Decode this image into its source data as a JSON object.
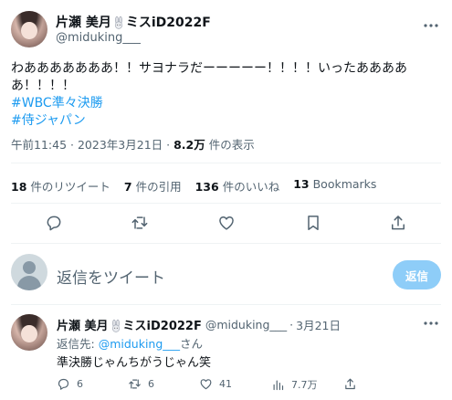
{
  "tweet": {
    "author_name": "片瀬 美月",
    "author_name_suffix": "ミスiD2022F",
    "author_handle": "@miduking___",
    "text": "わあああああああ！！サヨナラだーーーーー！！！！いったあああああ！！！！",
    "hashtags": [
      "#WBC準々決勝",
      "#侍ジャパン"
    ],
    "time": "午前11:45",
    "date": "2023年3月21日",
    "views_count": "8.2万",
    "views_label": "件の表示",
    "separator": "·"
  },
  "stats": [
    {
      "count": "18",
      "label": "件のリツイート"
    },
    {
      "count": "7",
      "label": "件の引用"
    },
    {
      "count": "136",
      "label": "件のいいね"
    },
    {
      "count": "13",
      "label": "Bookmarks"
    }
  ],
  "actions": [
    "reply-icon",
    "retweet-icon",
    "like-icon",
    "bookmark-icon",
    "share-icon"
  ],
  "reply_composer": {
    "placeholder": "返信をツイート",
    "button_label": "返信"
  },
  "reply": {
    "author_name": "片瀬 美月",
    "author_name_suffix": "ミスiD2022F",
    "author_handle": "@miduking___",
    "date": "3月21日",
    "separator": "·",
    "reply_to_prefix": "返信先:",
    "reply_to_handle": "@miduking___",
    "reply_to_suffix": "さん",
    "text": "準決勝じゃんちがうじゃん笑",
    "actions": [
      {
        "icon": "reply-icon",
        "count": "6"
      },
      {
        "icon": "retweet-icon",
        "count": "6"
      },
      {
        "icon": "like-icon",
        "count": "41"
      },
      {
        "icon": "views-icon",
        "count": "7.7万"
      },
      {
        "icon": "share-icon",
        "count": ""
      }
    ]
  },
  "colors": {
    "text": "#0f1419",
    "secondary": "#536471",
    "link": "#1d9bf0",
    "reply_button": "#8ecdf8",
    "divider": "#eff3f4"
  }
}
